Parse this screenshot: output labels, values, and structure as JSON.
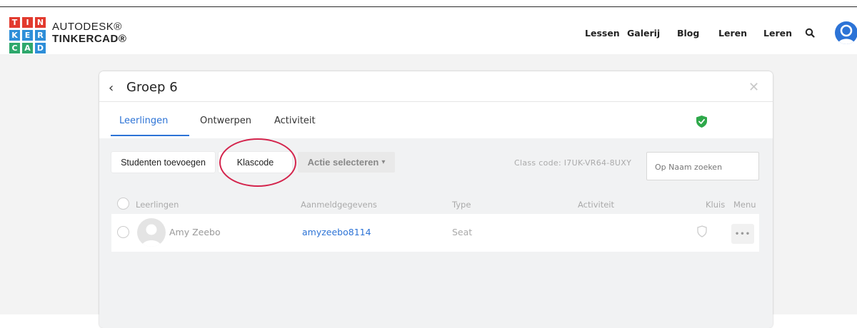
{
  "header": {
    "logo_letters": [
      "T",
      "I",
      "N",
      "K",
      "E",
      "R",
      "C",
      "A",
      "D"
    ],
    "logo_colors": [
      "#e23a2e",
      "#e23a2e",
      "#e23a2e",
      "#2e8ed8",
      "#2e8ed8",
      "#2e8ed8",
      "#2ea86c",
      "#2ea86c",
      "#2e8ed8"
    ],
    "brand_line1": "AUTODESK®",
    "brand_line2": "TINKERCAD®",
    "nav": [
      "Lessen",
      "Galerij",
      "Blog",
      "Leren",
      "Leren"
    ],
    "search_icon": "search-icon",
    "avatar_icon": "user-avatar-icon"
  },
  "dialog": {
    "title": "Groep 6",
    "back_icon": "chevron-left-icon",
    "close_icon": "close-icon",
    "tabs": [
      "Leerlingen",
      "Ontwerpen",
      "Activiteit"
    ],
    "active_tab": "Leerlingen",
    "shield_color": "#2ea84a"
  },
  "toolbar": {
    "add_students": "Studenten toevoegen",
    "class_code_button": "Klascode",
    "select_action": "Actie selecteren",
    "class_code_text": "Class code: I7UK-VR64-8UXY",
    "search_placeholder": "Op Naam zoeken"
  },
  "table": {
    "headers": [
      "Leerlingen",
      "Aanmeldgegevens",
      "Type",
      "Activiteit",
      "Kluis",
      "Menu"
    ],
    "rows": [
      {
        "name": "Amy Zeebo",
        "login": "amyzeebo8114",
        "type": "Seat",
        "activity": "",
        "menu": "•••"
      }
    ]
  },
  "accent": "#2c73d6",
  "highlight_ring_color": "#d4244c"
}
